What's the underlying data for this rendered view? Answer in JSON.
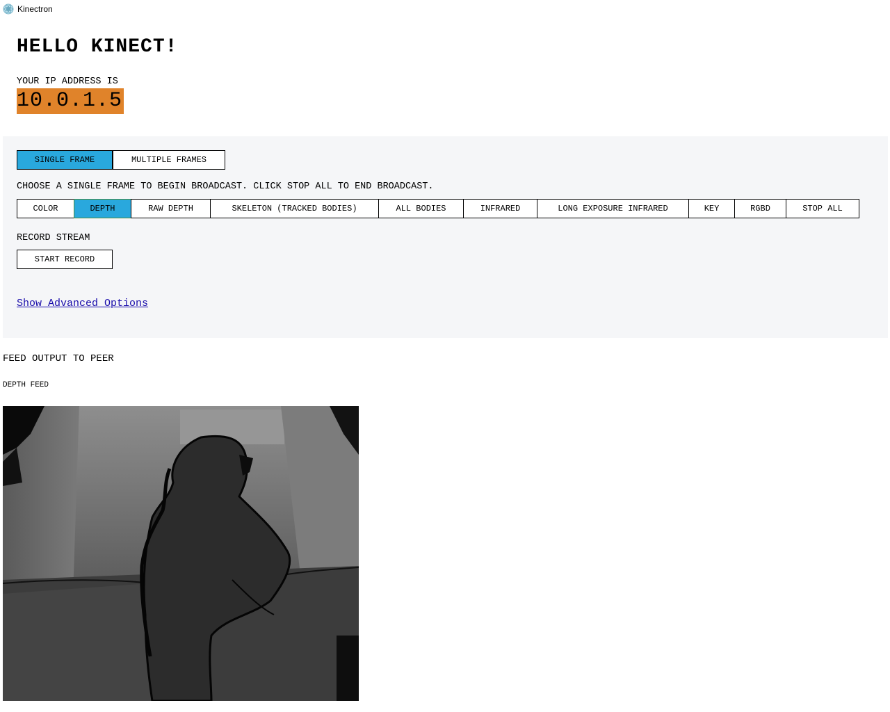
{
  "window": {
    "title": "Kinectron",
    "icon": "kinectron-app-icon"
  },
  "header": {
    "title": "HELLO KINECT!",
    "ip_label": "YOUR IP ADDRESS IS",
    "ip_value": "10.0.1.5",
    "ip_highlight_color": "#e0832a"
  },
  "frame_mode": {
    "tabs": [
      {
        "label": "SINGLE FRAME",
        "active": true
      },
      {
        "label": "MULTIPLE FRAMES",
        "active": false
      }
    ]
  },
  "broadcast": {
    "instruction": "CHOOSE A SINGLE FRAME TO BEGIN BROADCAST. CLICK STOP ALL TO END BROADCAST.",
    "buttons": [
      {
        "label": "COLOR",
        "active": false
      },
      {
        "label": "DEPTH",
        "active": true
      },
      {
        "label": "RAW DEPTH",
        "active": false
      },
      {
        "label": "SKELETON (TRACKED BODIES)",
        "active": false
      },
      {
        "label": "ALL BODIES",
        "active": false
      },
      {
        "label": "INFRARED",
        "active": false
      },
      {
        "label": "LONG EXPOSURE INFRARED",
        "active": false
      },
      {
        "label": "KEY",
        "active": false
      },
      {
        "label": "RGBD",
        "active": false
      },
      {
        "label": "STOP ALL",
        "active": false
      }
    ],
    "active_color": "#29a8dd"
  },
  "record": {
    "label": "RECORD STREAM",
    "button": "START RECORD"
  },
  "advanced": {
    "link": "Show Advanced Options"
  },
  "feed": {
    "title": "FEED OUTPUT TO PEER",
    "subtitle": "DEPTH FEED"
  }
}
